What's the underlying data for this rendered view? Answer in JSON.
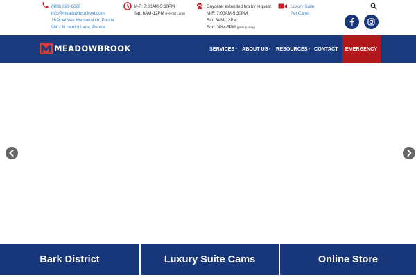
{
  "contact": {
    "phone": "(309) 682-6665",
    "email": "info@meadowbrookvet.com",
    "address_1": "1624 W War Memorial Dr, Peoria",
    "address_2": "9802 N Herriot Lane, Peoria"
  },
  "hours": {
    "weekday": "M-F: 7:00AM-5:30PM",
    "saturday": "Sat: 8AM-12PM",
    "saturday_note": "(Herriot Lane)"
  },
  "daycare": {
    "line_1": "Daycare: extended hrs by request",
    "line_2": "M-F: 7:00AM-5:30PM",
    "line_3": "Sat: 8AM-12PM",
    "line_4": "Sun: 3PM-5PM",
    "line_4_note": "(pickup only)"
  },
  "cams": {
    "line_1": "Luxury Suite",
    "line_2": "Pet Cams"
  },
  "brand": {
    "logo_text": "MEADOWBROOK",
    "logo_color": "#e03b32"
  },
  "nav": {
    "services": "SERVICES",
    "about": "ABOUT US",
    "resources": "RESOURCES",
    "contact": "CONTACT",
    "emergency": "EMERGENCY",
    "caret": "˅"
  },
  "tiles": {
    "bark_district": "Bark District",
    "luxury_cams": "Luxury Suite Cams",
    "online_store": "Online Store"
  },
  "icons": {
    "phone": "phone-icon",
    "clock": "clock-icon",
    "paw": "paw-icon",
    "camera": "video-camera-icon",
    "search": "search-icon",
    "facebook": "facebook-icon",
    "instagram": "instagram-icon",
    "prev": "chevron-left-icon",
    "next": "chevron-right-icon"
  },
  "colors": {
    "navy": "#1a3a7e",
    "emergency_red": "#b0191c",
    "icon_red": "#c8202a",
    "link_blue": "#3a7fc1"
  }
}
